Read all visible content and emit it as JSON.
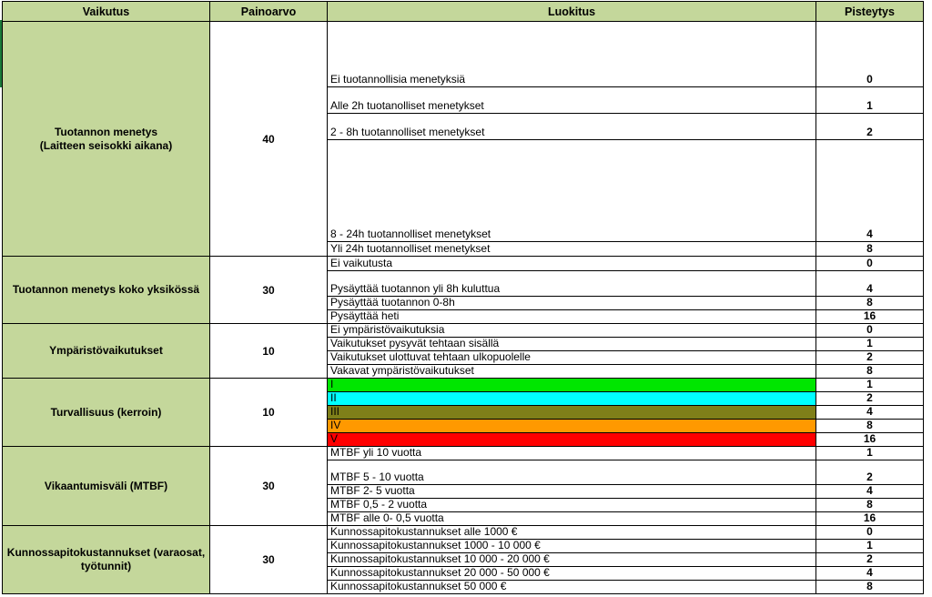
{
  "headers": {
    "vaikutus": "Vaikutus",
    "painoarvo": "Painoarvo",
    "luokitus": "Luokitus",
    "pisteytys": "Pisteytys"
  },
  "groups": [
    {
      "title_line1": "Tuotannon menetys",
      "title_line2": "(Laitteen seisokki aikana)",
      "weight": "40",
      "rows": [
        {
          "label": "Ei tuotannollisia menetyksiä",
          "points": "0"
        },
        {
          "label": "Alle 2h tuotanolliset menetykset",
          "points": "1"
        },
        {
          "label": "2 - 8h tuotannolliset menetykset",
          "points": "2"
        },
        {
          "label": "8 - 24h tuotannolliset menetykset",
          "points": "4"
        },
        {
          "label": "Yli 24h tuotannolliset menetykset",
          "points": "8"
        }
      ]
    },
    {
      "title_line1": "Tuotannon menetys koko yksikössä",
      "weight": "30",
      "rows": [
        {
          "label": "Ei vaikutusta",
          "points": "0"
        },
        {
          "label": "Pysäyttää tuotannon yli 8h kuluttua",
          "points": "4"
        },
        {
          "label": "Pysäyttää tuotannon 0-8h",
          "points": "8"
        },
        {
          "label": "Pysäyttää heti",
          "points": "16"
        }
      ]
    },
    {
      "title_line1": "Ympäristövaikutukset",
      "weight": "10",
      "rows": [
        {
          "label": "Ei ympäristövaikutuksia",
          "points": "0"
        },
        {
          "label": "Vaikutukset pysyvät tehtaan sisällä",
          "points": "1"
        },
        {
          "label": "Vaikutukset ulottuvat tehtaan ulkopuolelle",
          "points": "2"
        },
        {
          "label": "Vakavat ympäristövaikutukset",
          "points": "8"
        }
      ]
    },
    {
      "title_line1": "Turvallisuus (kerroin)",
      "weight": "10",
      "rows": [
        {
          "label": "I",
          "points": "1",
          "color": "#00e600"
        },
        {
          "label": "II",
          "points": "2",
          "color": "#00ffff"
        },
        {
          "label": "III",
          "points": "4",
          "color": "#7f7f19"
        },
        {
          "label": "IV",
          "points": "8",
          "color": "#ff9900"
        },
        {
          "label": "V",
          "points": "16",
          "color": "#ff0000"
        }
      ]
    },
    {
      "title_line1": "Vikaantumisväli (MTBF)",
      "weight": "30",
      "rows": [
        {
          "label": "MTBF yli 10 vuotta",
          "points": "1"
        },
        {
          "label": "MTBF 5 - 10 vuotta",
          "points": "2"
        },
        {
          "label": "MTBF 2- 5 vuotta",
          "points": "4"
        },
        {
          "label": "MTBF 0,5 - 2 vuotta",
          "points": "8"
        },
        {
          "label": "MTBF alle 0- 0,5 vuotta",
          "points": "16"
        }
      ]
    },
    {
      "title_line1": "Kunnossapitokustannukset (varaosat,",
      "title_line2": "työtunnit)",
      "weight": "30",
      "rows": [
        {
          "label": "Kunnossapitokustannukset alle 1000 €",
          "points": "0"
        },
        {
          "label": "Kunnossapitokustannukset 1000 - 10 000 €",
          "points": "1"
        },
        {
          "label": "Kunnossapitokustannukset 10 000 - 20 000 €",
          "points": "2"
        },
        {
          "label": "Kunnossapitokustannukset 20 000 - 50 000 €",
          "points": "4"
        },
        {
          "label": "Kunnossapitokustannukset 50 000 €",
          "points": "8"
        }
      ]
    }
  ]
}
